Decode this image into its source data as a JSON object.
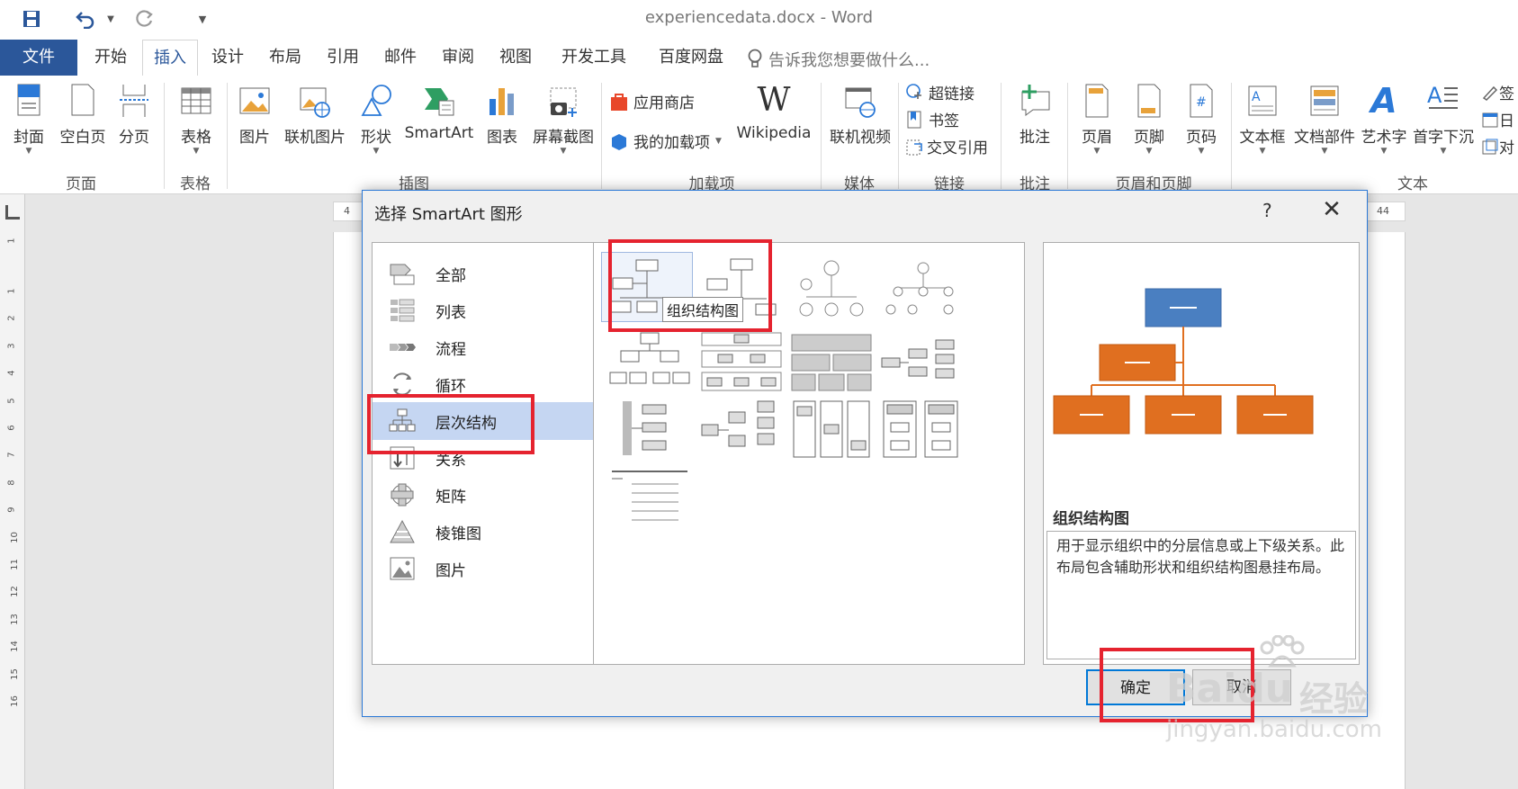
{
  "window": {
    "title": "experiencedata.docx - Word"
  },
  "tabs": [
    "文件",
    "开始",
    "插入",
    "设计",
    "布局",
    "引用",
    "邮件",
    "审阅",
    "视图",
    "开发工具",
    "百度网盘"
  ],
  "tell_me": "告诉我您想要做什么...",
  "ribbon": {
    "pages": {
      "cover": "封面",
      "blank": "空白页",
      "break": "分页",
      "group": "页面"
    },
    "tables": {
      "table": "表格",
      "group": "表格"
    },
    "illustrations": {
      "picture": "图片",
      "online_picture": "联机图片",
      "shapes": "形状",
      "smartart": "SmartArt",
      "chart": "图表",
      "screenshot": "屏幕截图",
      "group": "插图"
    },
    "addins": {
      "store": "应用商店",
      "my_addins": "我的加载项",
      "wikipedia": "Wikipedia",
      "group": "加载项"
    },
    "media": {
      "online_video": "联机视频",
      "group": "媒体"
    },
    "links": {
      "hyperlink": "超链接",
      "bookmark": "书签",
      "crossref": "交叉引用",
      "group": "链接"
    },
    "comments": {
      "comment": "批注",
      "group": "批注"
    },
    "header_footer": {
      "header": "页眉",
      "footer": "页脚",
      "page_number": "页码",
      "group": "页眉和页脚"
    },
    "text": {
      "textbox": "文本框",
      "quickparts": "文档部件",
      "wordart": "艺术字",
      "dropcap": "首字下沉",
      "side1": "签",
      "side2": "日",
      "side3": "对",
      "group": "文本"
    }
  },
  "ruler": {
    "left_num": "4",
    "right_num": "44",
    "vertical": [
      "1",
      "1",
      "2",
      "3",
      "4",
      "5",
      "6",
      "7",
      "8",
      "9",
      "10",
      "11",
      "12",
      "13",
      "14",
      "15",
      "16"
    ]
  },
  "dialog": {
    "title": "选择 SmartArt 图形",
    "help": "?",
    "close": "✕",
    "categories": [
      {
        "label": "全部",
        "icon": "all-icon"
      },
      {
        "label": "列表",
        "icon": "list-icon"
      },
      {
        "label": "流程",
        "icon": "process-icon"
      },
      {
        "label": "循环",
        "icon": "cycle-icon"
      },
      {
        "label": "层次结构",
        "icon": "hierarchy-icon",
        "selected": true
      },
      {
        "label": "关系",
        "icon": "relationship-icon"
      },
      {
        "label": "矩阵",
        "icon": "matrix-icon"
      },
      {
        "label": "棱锥图",
        "icon": "pyramid-icon"
      },
      {
        "label": "图片",
        "icon": "picture-icon"
      }
    ],
    "tooltip": "组织结构图",
    "preview": {
      "title": "组织结构图",
      "description": "用于显示组织中的分层信息或上下级关系。此布局包含辅助形状和组织结构图悬挂布局。"
    },
    "ok": "确定",
    "cancel": "取消"
  },
  "watermark": {
    "brand": "Bai",
    "du": "du",
    "jingyan": "经验",
    "url": "jingyan.baidu.com"
  },
  "colors": {
    "accent": "#2b579a",
    "selection": "#c5d6f2",
    "highlight": "#e5232f",
    "preview_blue": "#4a7fc1",
    "preview_orange": "#e06f20"
  }
}
